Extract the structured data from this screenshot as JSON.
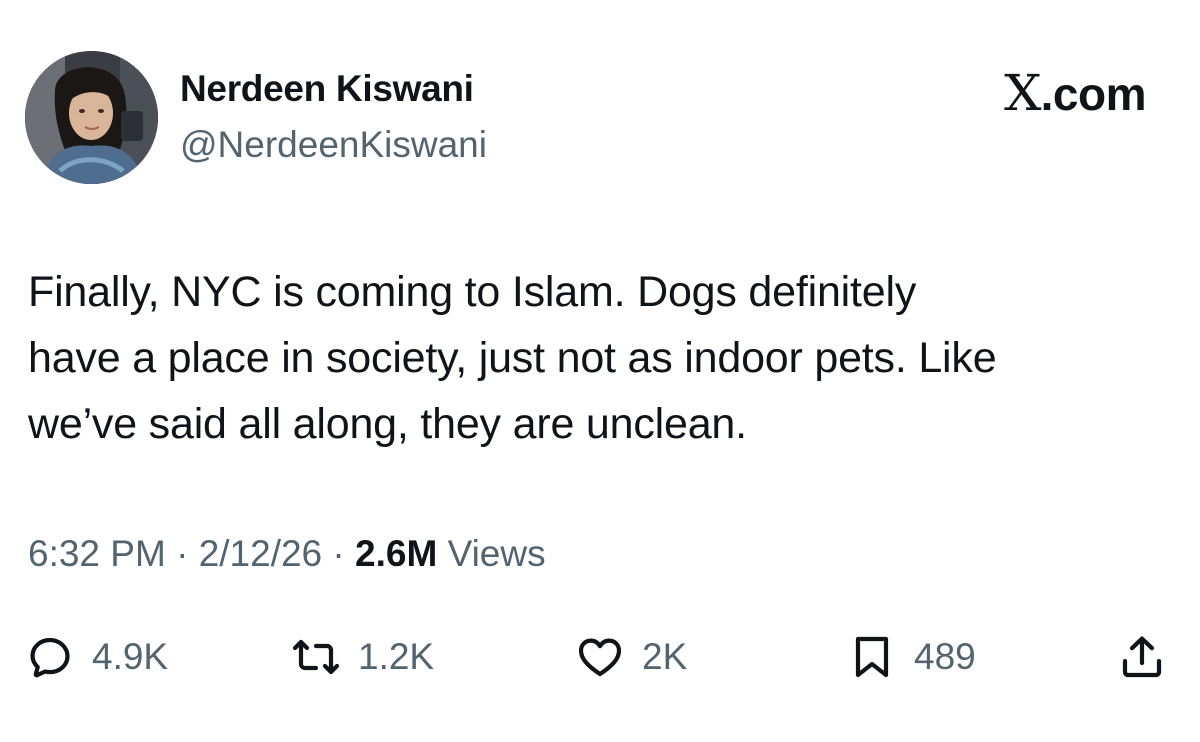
{
  "author": {
    "display_name": "Nerdeen Kiswani",
    "handle": "@NerdeenKiswani",
    "avatar_icon": "profile-photo"
  },
  "brand": {
    "logo_letter": "X",
    "logo_suffix": ".com"
  },
  "tweet": {
    "text": "Finally, NYC is coming to Islam. Dogs definitely\nhave a place in society, just not as indoor pets. Like\nwe’ve said all along, they are unclean."
  },
  "meta": {
    "time": "6:32 PM",
    "separator": "·",
    "date": "2/12/26",
    "views_count": "2.6M",
    "views_label": "Views"
  },
  "actions": {
    "replies": {
      "icon": "reply-icon",
      "count": "4.9K"
    },
    "reposts": {
      "icon": "retweet-icon",
      "count": "1.2K"
    },
    "likes": {
      "icon": "heart-icon",
      "count": "2K"
    },
    "bookmarks": {
      "icon": "bookmark-icon",
      "count": "489"
    },
    "share": {
      "icon": "share-icon"
    }
  },
  "colors": {
    "text_primary": "#0f1419",
    "text_secondary": "#536471",
    "background": "#ffffff"
  }
}
